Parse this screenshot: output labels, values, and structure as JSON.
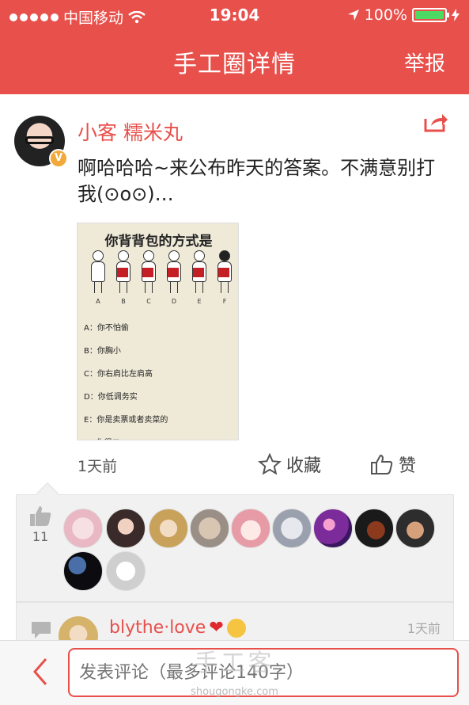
{
  "status_bar": {
    "carrier": "中国移动",
    "time": "19:04",
    "battery": "100%"
  },
  "nav": {
    "title": "手工圈详情",
    "report": "举报"
  },
  "post": {
    "author": "小客 糯米丸",
    "badge": "V",
    "text": "啊哈哈哈~来公布昨天的答案。不满意别打我(⊙o⊙)…",
    "image": {
      "title": "你背背包的方式是",
      "letters": [
        "A",
        "B",
        "C",
        "D",
        "E",
        "F"
      ],
      "options": [
        "A：你不怕偷",
        "B：你胸小",
        "C：你右肩比左肩高",
        "D：你低调务实",
        "E：你是卖票或者卖菜的",
        "F：你很二"
      ]
    },
    "time": "1天前",
    "favorite_label": "收藏",
    "like_label": "赞"
  },
  "likes": {
    "count": "11"
  },
  "comment": {
    "name": "blythe·love",
    "time": "1天前"
  },
  "input": {
    "placeholder": "发表评论（最多评论140字）"
  },
  "watermark": {
    "main": "手工客",
    "sub": "shougongke.com"
  },
  "colors": {
    "accent": "#e8504b",
    "panel": "#f1f1f1"
  }
}
